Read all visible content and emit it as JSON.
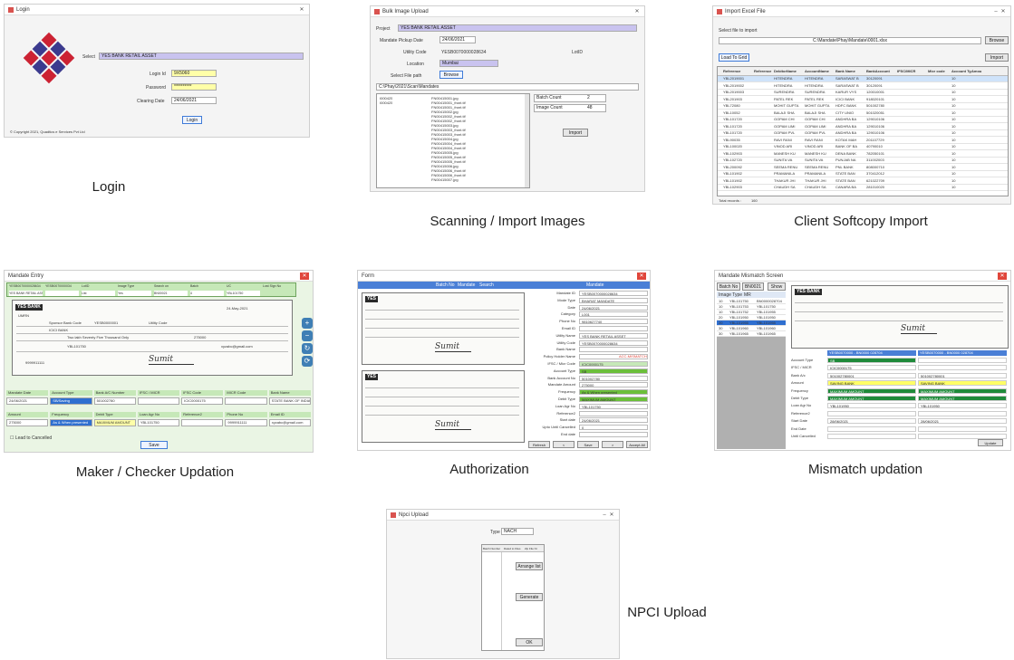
{
  "captions": {
    "login": "Login",
    "scanning": "Scanning / Import Images",
    "softcopy": "Client Softcopy Import",
    "maker": "Maker / Checker Updation",
    "auth": "Authorization",
    "mismatch": "Mismatch updation",
    "npci": "NPCI Upload"
  },
  "login": {
    "title": "Login",
    "select_label": "Select",
    "select_value": "YES BANK RETAIL ASSET",
    "login_id_label": "Login Id",
    "login_id_value": "9X5060",
    "password_label": "Password",
    "password_value": "**********",
    "clearing_label": "Clearing Date",
    "clearing_value": "24/06/2021",
    "login_button": "Login",
    "copyright": "© Copyright 2021, Quadtics e Services Pvt Ltd"
  },
  "scan": {
    "title": "Bulk Image Upload",
    "project_label": "Project",
    "project_value": "YES BANK RETAIL ASSET",
    "pickup_label": "Mandate Pickup Date",
    "pickup_value": "24/06/2021",
    "utility_label": "Utility Code",
    "utility_value": "YESB0070000028634",
    "lot_label": "LotID",
    "location_label": "Location",
    "location_value": "Mumbai",
    "filepath_label": "Select File path",
    "browse_button": "Browse",
    "path_value": "C:\\Phay\\2021\\Scan\\Mandates",
    "batch_ids": [
      "I000425",
      "I000425"
    ],
    "files": [
      "FN00415001.jpg",
      "FN00415001_front.tif",
      "FN00415001_front.tif",
      "FN00415002.jpg",
      "FN00415002_front.tif",
      "FN00415002_front.tif",
      "FN00415003.jpg",
      "FN00415003_front.tif",
      "FN00415003_front.tif",
      "FN00415004.jpg",
      "FN00415004_front.tif",
      "FN00415004_front.tif",
      "FN00415005.jpg",
      "FN00415005_front.tif",
      "FN00415005_front.tif",
      "FN00415006.jpg",
      "FN00415006_front.tif",
      "FN00415006_front.tif",
      "FN00415007.jpg"
    ],
    "batch_count_label": "Batch Count",
    "batch_count_value": "2",
    "image_count_label": "Image Count",
    "image_count_value": "48",
    "import_button": "Import"
  },
  "softcopy": {
    "title": "Import Excel File",
    "select_label": "Select file to import",
    "path_value": "C:\\Mandate\\Phay\\Mandate\\0001.xlsx",
    "browse_button": "Browse",
    "load_button": "Load To Grid",
    "import_button": "Import",
    "columns": [
      "Reference",
      "Reference",
      "DebitorName",
      "AccountName",
      "Bank Name",
      "BankAccount",
      "IFSC/MICR",
      "Micr code",
      "Account Type",
      "Amou"
    ],
    "rows": [
      [
        "YBL2019001",
        "",
        "HITENDRA",
        "HITENDRA",
        "SARASWAT B",
        "30120091",
        "",
        "",
        "10"
      ],
      [
        "YBL2019002",
        "",
        "HITENDRA",
        "HITENDRA",
        "SARASWAT B",
        "30120091",
        "",
        "",
        "10"
      ],
      [
        "YBL2019003",
        "",
        "SURENDRA",
        "SURENDRA",
        "KARUR VYS",
        "120010001",
        "",
        "",
        "10"
      ],
      [
        "YBL201903",
        "",
        "PATEL REK",
        "PATEL REK",
        "ICICI BANK",
        "918020101",
        "",
        "",
        "10"
      ],
      [
        "YBL72080",
        "",
        "MOHIT GUPTA",
        "MOHIT GUPTA",
        "HDFC BANK",
        "501002780",
        "",
        "",
        "10"
      ],
      [
        "YBL10052",
        "",
        "BALAJI SHA",
        "BALAJI SHA",
        "CITY UNIO",
        "501020051",
        "",
        "",
        "10"
      ],
      [
        "YBL101720",
        "",
        "GOPAM CHI",
        "GOPAM CHI",
        "ANDHRA BA",
        "129010106",
        "",
        "",
        "10"
      ],
      [
        "YBL101720",
        "",
        "GOPAM LIMI",
        "GOPAM LIMI",
        "ANDHRA BA",
        "129010106",
        "",
        "",
        "10"
      ],
      [
        "YBL101720",
        "",
        "GOPAM PVL",
        "GOPAM PVL",
        "ANDHRA BA",
        "129010106",
        "",
        "",
        "10"
      ],
      [
        "YBL90035",
        "",
        "RAVI RANI",
        "RAVI RANI",
        "KOTAK MAH",
        "201107729",
        "",
        "",
        "10"
      ],
      [
        "YBL100020",
        "",
        "VINOD ARI",
        "VINOD ARI",
        "BANK OF BA",
        "40790010",
        "",
        "",
        "10"
      ],
      [
        "YBL102903",
        "",
        "MANESH KU",
        "MANESH KU",
        "DENA BANK",
        "782050101",
        "",
        "",
        "10"
      ],
      [
        "YBL102720",
        "",
        "SUNITA VA",
        "SUNITA VA",
        "PUNJAB NA",
        "311002003",
        "",
        "",
        "10"
      ],
      [
        "YBL200092",
        "",
        "SEEMA RENU",
        "SEEMA RENU",
        "PNL BANK",
        "808000710",
        "",
        "",
        "10"
      ],
      [
        "YBL101902",
        "",
        "PRAMANILA",
        "PRAMANILA",
        "STATE BAN",
        "370412012",
        "",
        "",
        "10"
      ],
      [
        "YBL101902",
        "",
        "THAKUR JHI",
        "THAKUR JHI",
        "STATE BAN",
        "621022709",
        "",
        "",
        "10"
      ],
      [
        "YBL102903",
        "",
        "CHAUDH SA",
        "CHAUDH SA",
        "CANARA BA",
        "281010020",
        "",
        "",
        "10"
      ]
    ],
    "total_label": "Total records :",
    "total_value": "160"
  },
  "maker": {
    "title": "Mandate Entry",
    "headers": [
      "YESB0070000028634",
      "YESB0070000034",
      "LotID",
      "Image Type",
      "Search on",
      "Batch",
      "UC",
      "Lost Sign No"
    ],
    "header_values": [
      "YES BANK RETAIL ASSET",
      "",
      "List",
      "Yes",
      "BN00021",
      "4",
      "YBL101750"
    ],
    "bank_tag": "YES BANK",
    "umrn_label": "UMRN",
    "date_value": "24-May-2021",
    "sponsor_label": "Sponsor Bank Code",
    "sponsor_value": "YESB0000001",
    "utility_label": "Utility Code",
    "bank_name": "ICICI BANK",
    "amount_words": "Two lakh Seventy Five Thousand Only",
    "amount_value": "275000",
    "ref_value": "YBL101750",
    "phone_value": "9999911111",
    "email_value": "xyzabc@gmail.com",
    "signature": "Sumit",
    "bottom_labels": [
      "Mandate Date",
      "Account Type",
      "Bank A/C Number",
      "IFSC / MICR",
      "IFSC Code",
      "MICR Code",
      "Bank Name"
    ],
    "bottom_values": [
      "24/06/2021",
      "SB/Saving",
      "501002780",
      "",
      "ICIC0000175",
      "",
      "STATE BANK OF INDIA"
    ],
    "bottom2_labels": [
      "Amount",
      "Frequency",
      "Debit Type",
      "Loan Agr No",
      "Reference2",
      "Phone No",
      "Email ID"
    ],
    "bottom2_values": [
      "275000",
      "As & When presented",
      "MAXIMUM AMOUNT",
      "YBL101750",
      "",
      "9999911111",
      "xyzabc@gmail.com"
    ],
    "checkbox_label": "Lead to Cancelled",
    "save_button": "Save"
  },
  "auth": {
    "title": "Form",
    "tabs": [
      "Batch No",
      "Mandate",
      "Search"
    ],
    "right_header": "Mandate",
    "fields": [
      [
        "Mandate ID",
        "YESB0070000028634"
      ],
      [
        "Mode Type",
        "BHARAT MANDATE"
      ],
      [
        "Date",
        "24/06/2021"
      ],
      [
        "Category",
        "L001"
      ],
      [
        "Phone No",
        "9810627740"
      ],
      [
        "Email ID",
        ""
      ],
      [
        "Utility Name",
        "YES BANK RETAIL ASSET"
      ],
      [
        "Utility Code",
        "YESB0070000028634"
      ],
      [
        "Bank Name",
        ""
      ],
      [
        "Policy Holder Name",
        ""
      ],
      [
        "IFSC / Micr Code",
        "ICIC0000175"
      ],
      [
        "Account Type",
        "SB"
      ],
      [
        "Bank Account No",
        "501002780"
      ],
      [
        "Mandate Amount",
        "275000"
      ],
      [
        "Frequency",
        "As & When presented"
      ],
      [
        "Debit Type",
        "MAXIMUM AMOUNT"
      ],
      [
        "Loan Agr No",
        "YBL101750"
      ],
      [
        "Reference2",
        ""
      ],
      [
        "Start date",
        "24/06/2021"
      ],
      [
        "Upto Until Cancelled",
        "0"
      ],
      [
        "End date",
        ""
      ]
    ],
    "mismatch_text": "ACC-MISMATCH",
    "micr_label": "MICR Code",
    "bottom_buttons": [
      "Refresh",
      "<",
      "Save",
      ">",
      "Accept All"
    ]
  },
  "mismatch": {
    "title": "Mandate Mismatch Screen",
    "tabs": [
      "Batch No",
      "BN0021",
      "Show"
    ],
    "sub_tabs": [
      "Image Type",
      "MR"
    ],
    "list": [
      [
        "10",
        "YBL101750",
        "BN0000028704"
      ],
      [
        "10",
        "YBL101753",
        "YBL101750"
      ],
      [
        "10",
        "YBL101752",
        "YBL101955"
      ],
      [
        "20",
        "YBL101950",
        "YBL101950"
      ],
      [
        "20",
        "YBL101955",
        "YBL101955"
      ],
      [
        "30",
        "YBL101960",
        "YBL101960"
      ],
      [
        "30",
        "YBL101965",
        "YBL101965"
      ]
    ],
    "compare_headers": [
      "YESB0070000 - BN0000 028704",
      "YESB0070000 - BN0000 028704"
    ],
    "compare_rows": [
      [
        "Account Type",
        "SB",
        ""
      ],
      [
        "IFSC / MICR",
        "ICIC0000175",
        ""
      ],
      [
        "Bank A/c",
        "501002780001",
        "501002780001"
      ],
      [
        "Amount",
        "SAVING BANK",
        "SAVING BANK"
      ],
      [
        "Frequency",
        "MAXIMUM AMOUNT",
        "MAXIMUM AMOUNT"
      ],
      [
        "Debit Type",
        "MAXIMUM AMOUNT",
        "MAXIMUM AMOUNT"
      ],
      [
        "Loan Agr No",
        "YBL101950",
        "YBL101950"
      ],
      [
        "Reference2",
        "",
        ""
      ],
      [
        "Start Date",
        "28/06/2021",
        "28/06/2021"
      ],
      [
        "End Date",
        "",
        ""
      ],
      [
        "Until Cancelled",
        "",
        ""
      ]
    ],
    "update_button": "Update"
  },
  "npci": {
    "title": "Npci Upload",
    "type_label": "Type",
    "type_value": "NACH",
    "columns": [
      "Batch Number",
      "Dated to Files",
      "Zip File Nr"
    ],
    "buttons": [
      "Arrange list",
      "Generate",
      "OK"
    ]
  },
  "colors": {
    "highlight_yellow": "#ffffa8",
    "highlight_purple": "#c9c3ef",
    "green_header": "#c6e8b8",
    "dark_green": "#1f8a3a",
    "blue_header": "#4a7fd6",
    "accent_red": "#e0463b"
  }
}
